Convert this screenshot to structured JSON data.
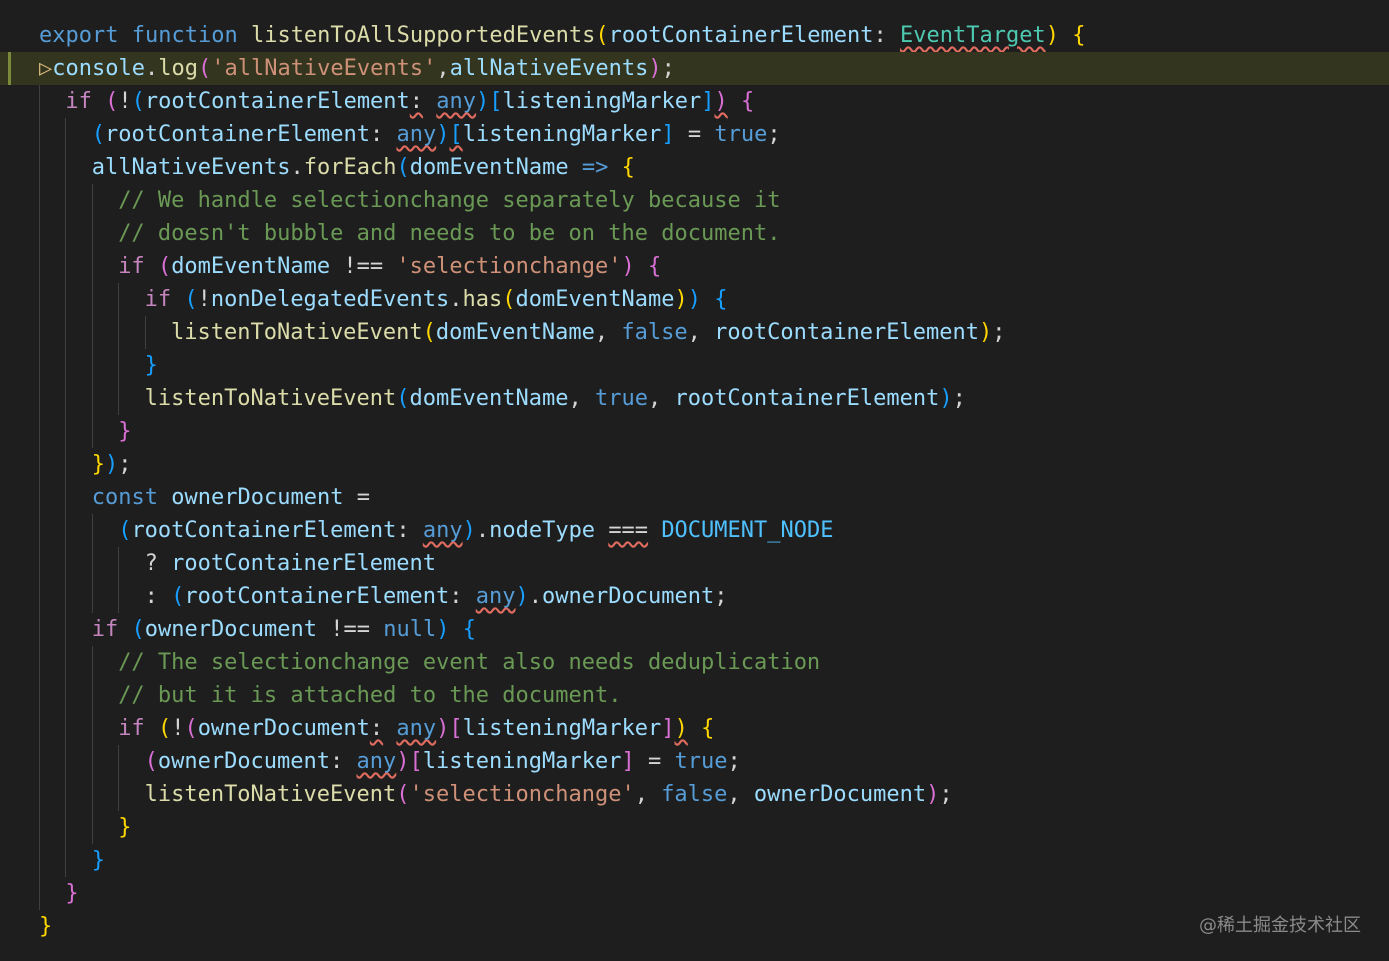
{
  "colors": {
    "keyword": "#569cd6",
    "control": "#c586c0",
    "function": "#dcdcaa",
    "variable": "#9cdcfe",
    "string": "#ce9178",
    "comment": "#6a9955",
    "type": "#4ec9b0",
    "constant": "#4fc1ff",
    "plain": "#d4d4d4",
    "brace1": "#ffd700",
    "brace2": "#da70d6",
    "brace3": "#179fff"
  },
  "editor": {
    "lines": [
      {
        "indent": 0,
        "tokens": [
          {
            "t": "export",
            "c": "keyword"
          },
          {
            "t": " "
          },
          {
            "t": "function",
            "c": "keyword"
          },
          {
            "t": " "
          },
          {
            "t": "listenToAllSupportedEvents",
            "c": "function"
          },
          {
            "t": "(",
            "c": "brace1"
          },
          {
            "t": "rootContainerElement",
            "c": "variable"
          },
          {
            "t": ": "
          },
          {
            "t": "EventTarget",
            "c": "type",
            "w": 1
          },
          {
            "t": ")",
            "c": "brace1"
          },
          {
            "t": " "
          },
          {
            "t": "{",
            "c": "brace1"
          }
        ]
      },
      {
        "indent": 0,
        "current": true,
        "tokens": [
          {
            "t": "▷",
            "c": "hint"
          },
          {
            "t": "console",
            "c": "variable"
          },
          {
            "t": "."
          },
          {
            "t": "log",
            "c": "function"
          },
          {
            "t": "(",
            "c": "brace2"
          },
          {
            "t": "'allNativeEvents'",
            "c": "string"
          },
          {
            "t": ","
          },
          {
            "t": "allNativeEvents",
            "c": "variable"
          },
          {
            "t": ")",
            "c": "brace2"
          },
          {
            "t": ";"
          }
        ]
      },
      {
        "indent": 1,
        "tokens": [
          {
            "t": "if",
            "c": "control"
          },
          {
            "t": " "
          },
          {
            "t": "(",
            "c": "brace2"
          },
          {
            "t": "!"
          },
          {
            "t": "(",
            "c": "brace3"
          },
          {
            "t": "rootContainerElement",
            "c": "variable"
          },
          {
            "t": ":",
            "w": 1
          },
          {
            "t": " "
          },
          {
            "t": "any",
            "c": "keyword",
            "w": 1
          },
          {
            "t": ")",
            "c": "brace3"
          },
          {
            "t": "[",
            "c": "brace3"
          },
          {
            "t": "listeningMarker",
            "c": "variable"
          },
          {
            "t": "]",
            "c": "brace3"
          },
          {
            "t": ")",
            "c": "brace2",
            "w": 1
          },
          {
            "t": " "
          },
          {
            "t": "{",
            "c": "brace2"
          }
        ]
      },
      {
        "indent": 2,
        "tokens": [
          {
            "t": "(",
            "c": "brace3"
          },
          {
            "t": "rootContainerElement",
            "c": "variable"
          },
          {
            "t": ": "
          },
          {
            "t": "any",
            "c": "keyword",
            "w": 1
          },
          {
            "t": ")",
            "c": "brace3"
          },
          {
            "t": "[",
            "c": "brace3",
            "w": 1
          },
          {
            "t": "listeningMarker",
            "c": "variable"
          },
          {
            "t": "]",
            "c": "brace3"
          },
          {
            "t": " = "
          },
          {
            "t": "true",
            "c": "keyword"
          },
          {
            "t": ";"
          }
        ]
      },
      {
        "indent": 2,
        "tokens": [
          {
            "t": "allNativeEvents",
            "c": "variable"
          },
          {
            "t": "."
          },
          {
            "t": "forEach",
            "c": "function"
          },
          {
            "t": "(",
            "c": "brace3"
          },
          {
            "t": "domEventName",
            "c": "variable"
          },
          {
            "t": " "
          },
          {
            "t": "=>",
            "c": "keyword"
          },
          {
            "t": " "
          },
          {
            "t": "{",
            "c": "brace1"
          }
        ]
      },
      {
        "indent": 3,
        "tokens": [
          {
            "t": "// We handle selectionchange separately because it",
            "c": "comment"
          }
        ]
      },
      {
        "indent": 3,
        "tokens": [
          {
            "t": "// doesn't bubble and needs to be on the document.",
            "c": "comment"
          }
        ]
      },
      {
        "indent": 3,
        "tokens": [
          {
            "t": "if",
            "c": "control"
          },
          {
            "t": " "
          },
          {
            "t": "(",
            "c": "brace2"
          },
          {
            "t": "domEventName",
            "c": "variable"
          },
          {
            "t": " !== "
          },
          {
            "t": "'selectionchange'",
            "c": "string"
          },
          {
            "t": ")",
            "c": "brace2"
          },
          {
            "t": " "
          },
          {
            "t": "{",
            "c": "brace2"
          }
        ]
      },
      {
        "indent": 4,
        "tokens": [
          {
            "t": "if",
            "c": "control"
          },
          {
            "t": " "
          },
          {
            "t": "(",
            "c": "brace3"
          },
          {
            "t": "!"
          },
          {
            "t": "nonDelegatedEvents",
            "c": "variable"
          },
          {
            "t": "."
          },
          {
            "t": "has",
            "c": "function"
          },
          {
            "t": "(",
            "c": "brace1"
          },
          {
            "t": "domEventName",
            "c": "variable"
          },
          {
            "t": ")",
            "c": "brace1"
          },
          {
            "t": ")",
            "c": "brace3"
          },
          {
            "t": " "
          },
          {
            "t": "{",
            "c": "brace3"
          }
        ]
      },
      {
        "indent": 5,
        "tokens": [
          {
            "t": "listenToNativeEvent",
            "c": "function"
          },
          {
            "t": "(",
            "c": "brace1"
          },
          {
            "t": "domEventName",
            "c": "variable"
          },
          {
            "t": ", "
          },
          {
            "t": "false",
            "c": "keyword"
          },
          {
            "t": ", "
          },
          {
            "t": "rootContainerElement",
            "c": "variable"
          },
          {
            "t": ")",
            "c": "brace1"
          },
          {
            "t": ";"
          }
        ]
      },
      {
        "indent": 4,
        "tokens": [
          {
            "t": "}",
            "c": "brace3"
          }
        ]
      },
      {
        "indent": 4,
        "tokens": [
          {
            "t": "listenToNativeEvent",
            "c": "function"
          },
          {
            "t": "(",
            "c": "brace3"
          },
          {
            "t": "domEventName",
            "c": "variable"
          },
          {
            "t": ", "
          },
          {
            "t": "true",
            "c": "keyword"
          },
          {
            "t": ", "
          },
          {
            "t": "rootContainerElement",
            "c": "variable"
          },
          {
            "t": ")",
            "c": "brace3"
          },
          {
            "t": ";"
          }
        ]
      },
      {
        "indent": 3,
        "tokens": [
          {
            "t": "}",
            "c": "brace2"
          }
        ]
      },
      {
        "indent": 2,
        "tokens": [
          {
            "t": "}",
            "c": "brace1"
          },
          {
            "t": ")",
            "c": "brace3"
          },
          {
            "t": ";"
          }
        ]
      },
      {
        "indent": 2,
        "tokens": [
          {
            "t": "const",
            "c": "keyword"
          },
          {
            "t": " "
          },
          {
            "t": "ownerDocument",
            "c": "variable"
          },
          {
            "t": " ="
          }
        ]
      },
      {
        "indent": 3,
        "tokens": [
          {
            "t": "(",
            "c": "brace3"
          },
          {
            "t": "rootContainerElement",
            "c": "variable"
          },
          {
            "t": ": "
          },
          {
            "t": "any",
            "c": "keyword",
            "w": 1
          },
          {
            "t": ")",
            "c": "brace3"
          },
          {
            "t": "."
          },
          {
            "t": "nodeType",
            "c": "variable"
          },
          {
            "t": " "
          },
          {
            "t": "===",
            "w": 1
          },
          {
            "t": " "
          },
          {
            "t": "DOCUMENT_NODE",
            "c": "constant"
          }
        ]
      },
      {
        "indent": 4,
        "tokens": [
          {
            "t": "? "
          },
          {
            "t": "rootContainerElement",
            "c": "variable"
          }
        ]
      },
      {
        "indent": 4,
        "tokens": [
          {
            "t": ": "
          },
          {
            "t": "(",
            "c": "brace3"
          },
          {
            "t": "rootContainerElement",
            "c": "variable"
          },
          {
            "t": ": "
          },
          {
            "t": "any",
            "c": "keyword",
            "w": 1
          },
          {
            "t": ")",
            "c": "brace3"
          },
          {
            "t": "."
          },
          {
            "t": "ownerDocument",
            "c": "variable"
          },
          {
            "t": ";"
          }
        ]
      },
      {
        "indent": 2,
        "tokens": [
          {
            "t": "if",
            "c": "control"
          },
          {
            "t": " "
          },
          {
            "t": "(",
            "c": "brace3"
          },
          {
            "t": "ownerDocument",
            "c": "variable"
          },
          {
            "t": " !== "
          },
          {
            "t": "null",
            "c": "keyword"
          },
          {
            "t": ")",
            "c": "brace3"
          },
          {
            "t": " "
          },
          {
            "t": "{",
            "c": "brace3"
          }
        ]
      },
      {
        "indent": 3,
        "tokens": [
          {
            "t": "// The selectionchange event also needs deduplication",
            "c": "comment"
          }
        ]
      },
      {
        "indent": 3,
        "tokens": [
          {
            "t": "// but it is attached to the document.",
            "c": "comment"
          }
        ]
      },
      {
        "indent": 3,
        "tokens": [
          {
            "t": "if",
            "c": "control"
          },
          {
            "t": " "
          },
          {
            "t": "(",
            "c": "brace1"
          },
          {
            "t": "!"
          },
          {
            "t": "(",
            "c": "brace2"
          },
          {
            "t": "ownerDocument",
            "c": "variable"
          },
          {
            "t": ":",
            "w": 1
          },
          {
            "t": " "
          },
          {
            "t": "any",
            "c": "keyword",
            "w": 1
          },
          {
            "t": ")",
            "c": "brace2"
          },
          {
            "t": "[",
            "c": "brace2"
          },
          {
            "t": "listeningMarker",
            "c": "variable"
          },
          {
            "t": "]",
            "c": "brace2"
          },
          {
            "t": ")",
            "c": "brace1",
            "w": 1
          },
          {
            "t": " "
          },
          {
            "t": "{",
            "c": "brace1"
          }
        ]
      },
      {
        "indent": 4,
        "tokens": [
          {
            "t": "(",
            "c": "brace2"
          },
          {
            "t": "ownerDocument",
            "c": "variable"
          },
          {
            "t": ": "
          },
          {
            "t": "any",
            "c": "keyword",
            "w": 1
          },
          {
            "t": ")",
            "c": "brace2"
          },
          {
            "t": "[",
            "c": "brace2"
          },
          {
            "t": "listeningMarker",
            "c": "variable"
          },
          {
            "t": "]",
            "c": "brace2"
          },
          {
            "t": " = "
          },
          {
            "t": "true",
            "c": "keyword"
          },
          {
            "t": ";"
          }
        ]
      },
      {
        "indent": 4,
        "tokens": [
          {
            "t": "listenToNativeEvent",
            "c": "function"
          },
          {
            "t": "(",
            "c": "brace2"
          },
          {
            "t": "'selectionchange'",
            "c": "string"
          },
          {
            "t": ", "
          },
          {
            "t": "false",
            "c": "keyword"
          },
          {
            "t": ", "
          },
          {
            "t": "ownerDocument",
            "c": "variable"
          },
          {
            "t": ")",
            "c": "brace2"
          },
          {
            "t": ";"
          }
        ]
      },
      {
        "indent": 3,
        "tokens": [
          {
            "t": "}",
            "c": "brace1"
          }
        ]
      },
      {
        "indent": 2,
        "tokens": [
          {
            "t": "}",
            "c": "brace3"
          }
        ]
      },
      {
        "indent": 1,
        "tokens": [
          {
            "t": "}",
            "c": "brace2"
          }
        ]
      },
      {
        "indent": 0,
        "tokens": [
          {
            "t": "}",
            "c": "brace1"
          }
        ]
      }
    ]
  },
  "watermark": "@稀土掘金技术社区"
}
